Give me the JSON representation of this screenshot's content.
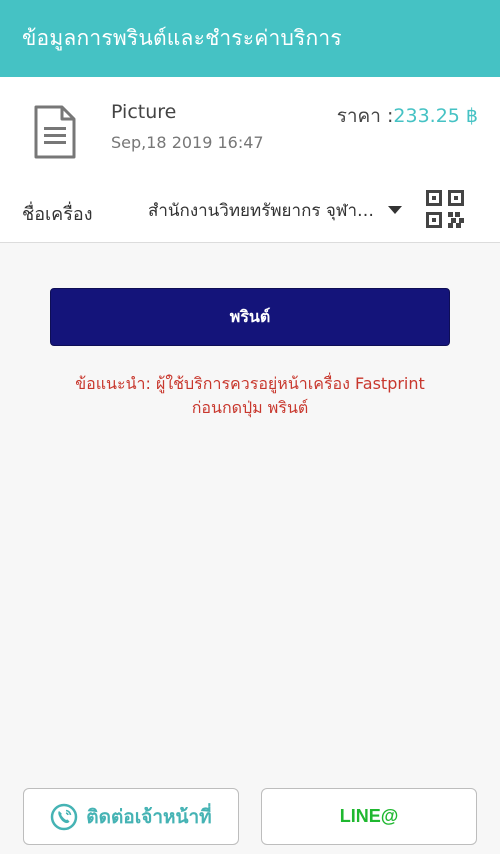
{
  "header": {
    "title": "ข้อมูลการพรินต์และชำระค่าบริการ"
  },
  "file": {
    "icon": "document-icon",
    "name": "Picture",
    "date": "Sep,18 2019 16:47",
    "price_label": "ราคา :",
    "price_value": "233.25 ฿"
  },
  "machine": {
    "label": "ชื่อเครื่อง",
    "selected": "สำนักงานวิทยทรัพยากร จุฬาลงกรณ์มหาวิทยาลัย",
    "qr_icon": "qr-code-icon"
  },
  "actions": {
    "print_label": "พรินต์"
  },
  "tip": {
    "line1": "ข้อแนะนำ: ผู้ใช้บริการควรอยู่หน้าเครื่อง Fastprint",
    "line2": "ก่อนกดปุ่ม พรินต์"
  },
  "bottom": {
    "contact_label": "ติดต่อเจ้าหน้าที่",
    "line_label": "LINE@"
  },
  "colors": {
    "accent": "#45c2c4",
    "print_button": "#14147a",
    "tip_text": "#c8372d",
    "line_green": "#1fb830"
  }
}
